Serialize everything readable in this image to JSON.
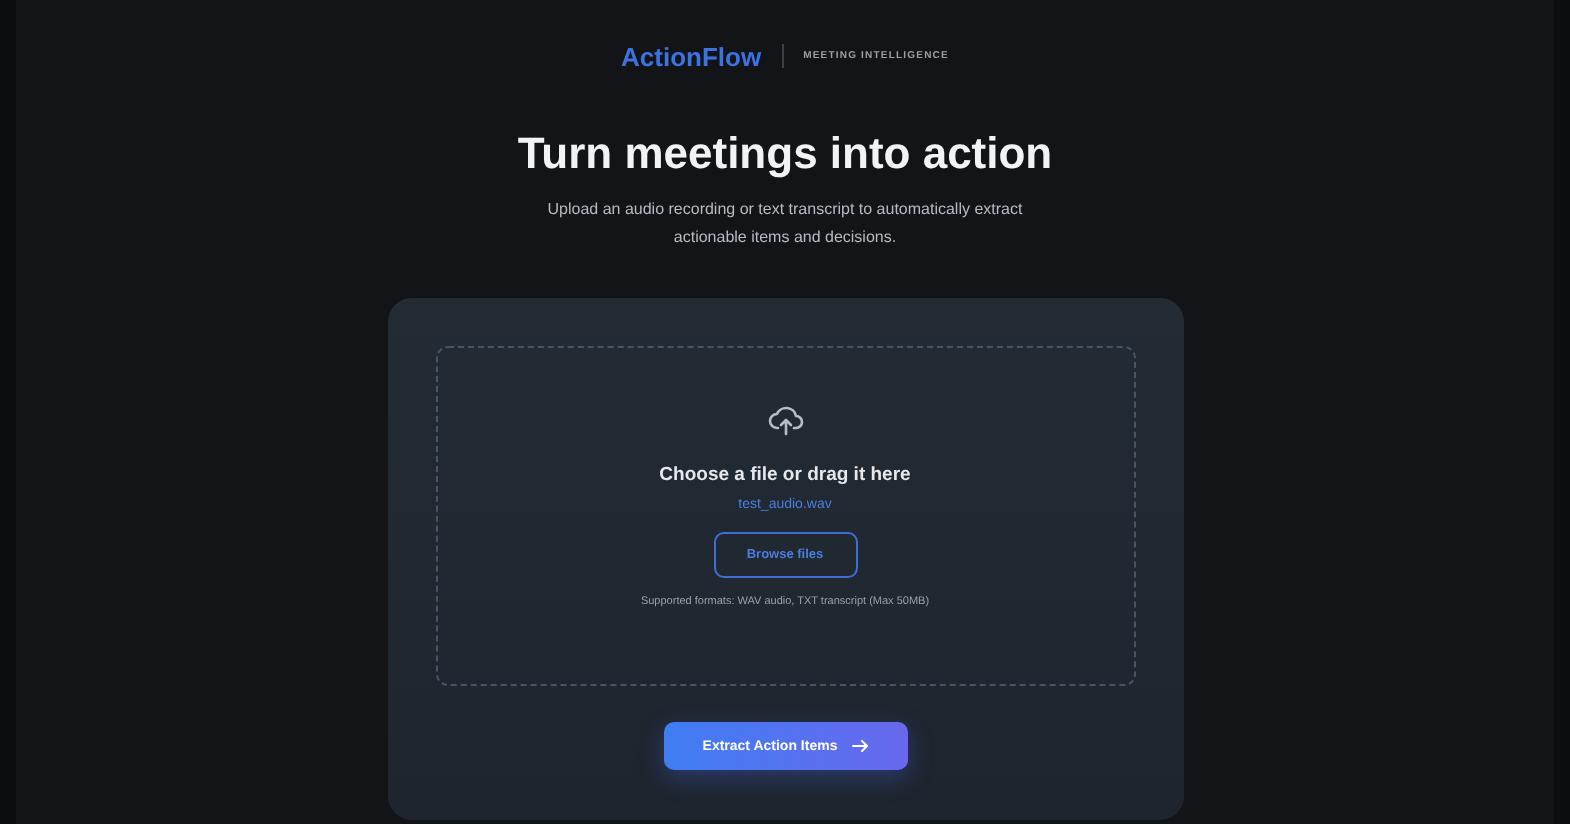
{
  "header": {
    "brand": "ActionFlow",
    "tagline": "MEETING INTELLIGENCE"
  },
  "hero": {
    "title": "Turn meetings into action",
    "subtitle": "Upload an audio recording or text transcript to automatically extract actionable items and decisions."
  },
  "upload": {
    "heading": "Choose a file or drag it here",
    "file_name": "test_audio.wav",
    "browse_button": "Browse files",
    "hint": "Supported formats: WAV audio, TXT transcript (Max 50MB)"
  },
  "submit_button": "Extract Action Items"
}
